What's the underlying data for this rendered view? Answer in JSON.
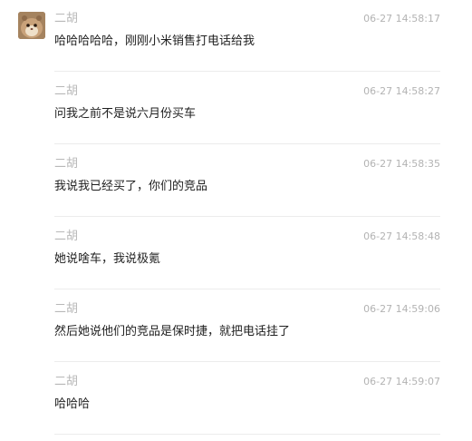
{
  "messages": [
    {
      "sender": "二胡",
      "time": "06-27 14:58:17",
      "text": "哈哈哈哈哈，刚刚小米销售打电话给我",
      "avatar": true
    },
    {
      "sender": "二胡",
      "time": "06-27 14:58:27",
      "text": "问我之前不是说六月份买车",
      "avatar": false
    },
    {
      "sender": "二胡",
      "time": "06-27 14:58:35",
      "text": "我说我已经买了，你们的竞品",
      "avatar": false
    },
    {
      "sender": "二胡",
      "time": "06-27 14:58:48",
      "text": "她说啥车，我说极氪",
      "avatar": false
    },
    {
      "sender": "二胡",
      "time": "06-27 14:59:06",
      "text": "然后她说他们的竞品是保时捷，就把电话挂了",
      "avatar": false
    },
    {
      "sender": "二胡",
      "time": "06-27 14:59:07",
      "text": "哈哈哈",
      "avatar": false
    }
  ],
  "icons": {
    "avatar": "hamster-avatar-icon"
  },
  "colors": {
    "sender": "#b8b8b8",
    "time": "#b3b3b3",
    "text": "#1f1f1f",
    "divider": "#ececec"
  }
}
